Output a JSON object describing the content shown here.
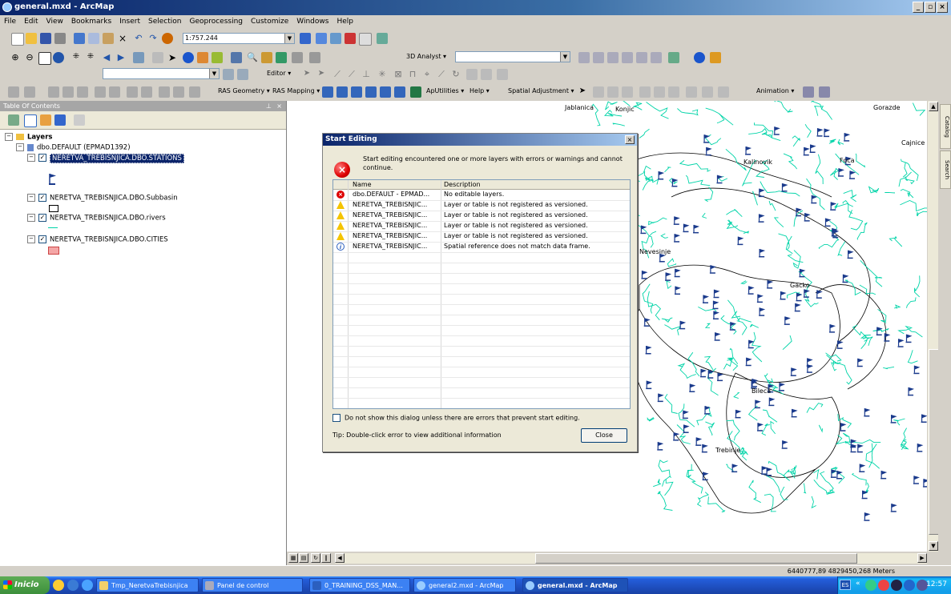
{
  "window": {
    "title": "general.mxd - ArcMap"
  },
  "menu": [
    "File",
    "Edit",
    "View",
    "Bookmarks",
    "Insert",
    "Selection",
    "Geoprocessing",
    "Customize",
    "Windows",
    "Help"
  ],
  "toolbar": {
    "scale": "1:757.244",
    "analyst3d_label": "3D Analyst ▾",
    "editor_label": "Editor ▾",
    "ras_geometry": "RAS Geometry ▾",
    "ras_mapping": "RAS Mapping ▾",
    "aputilities": "ApUtilities ▾",
    "help": "Help ▾",
    "spatial_adjustment": "Spatial Adjustment ▾",
    "animation": "Animation ▾"
  },
  "toc": {
    "title": "Table Of Contents",
    "root": "Layers",
    "database": "dbo.DEFAULT (EPMAD1392)",
    "layers": [
      {
        "name": "NERETVA_TREBISNJICA.DBO.STATIONS"
      },
      {
        "name": "NERETVA_TREBISNJICA.DBO.Subbasin"
      },
      {
        "name": "NERETVA_TREBISNJICA.DBO.rivers"
      },
      {
        "name": "NERETVA_TREBISNJICA.DBO.CITIES"
      }
    ]
  },
  "map": {
    "labels": [
      "Jablanica",
      "Konjic",
      "Gorazde",
      "Cajnice",
      "Kalinovik",
      "Foca",
      "Nevesinje",
      "Bileca",
      "Trebinje",
      "Gacko"
    ]
  },
  "dialog": {
    "title": "Start Editing",
    "message": "Start editing encountered one or more layers with errors or warnings and cannot continue.",
    "col_name": "Name",
    "col_desc": "Description",
    "rows": [
      {
        "type": "error",
        "name": "dbo.DEFAULT - EPMAD...",
        "desc": "No editable layers."
      },
      {
        "type": "warning",
        "name": "NERETVA_TREBISNJIC...",
        "desc": "Layer or table is not registered as versioned."
      },
      {
        "type": "warning",
        "name": "NERETVA_TREBISNJIC...",
        "desc": "Layer or table is not registered as versioned."
      },
      {
        "type": "warning",
        "name": "NERETVA_TREBISNJIC...",
        "desc": "Layer or table is not registered as versioned."
      },
      {
        "type": "warning",
        "name": "NERETVA_TREBISNJIC...",
        "desc": "Layer or table is not registered as versioned."
      },
      {
        "type": "info",
        "name": "NERETVA_TREBISNJIC...",
        "desc": "Spatial reference does not match data frame."
      }
    ],
    "checkbox": "Do not show this dialog unless there are errors that prevent start editing.",
    "tip": "Tip: Double-click error to view additional information",
    "close": "Close"
  },
  "status": {
    "coords": "6440777,89  4829450,268 Meters"
  },
  "side_tabs": [
    "Catalog",
    "Search"
  ],
  "taskbar": {
    "start": "Inicio",
    "items": [
      {
        "label": "Tmp_NeretvaTrebisnjica",
        "active": false
      },
      {
        "label": "Panel de control",
        "active": false
      },
      {
        "label": "0_TRAINING_DSS_MAN...",
        "active": false
      },
      {
        "label": "general2.mxd - ArcMap",
        "active": false
      },
      {
        "label": "general.mxd - ArcMap",
        "active": true
      }
    ],
    "lang": "ES",
    "time": "12:57"
  },
  "colors": {
    "rivers": "#00d4a8",
    "stations": "#1a3a8c",
    "subbasin_border": "#000000",
    "city_fill": "#f4a6a6",
    "selection": "#0a246a"
  }
}
